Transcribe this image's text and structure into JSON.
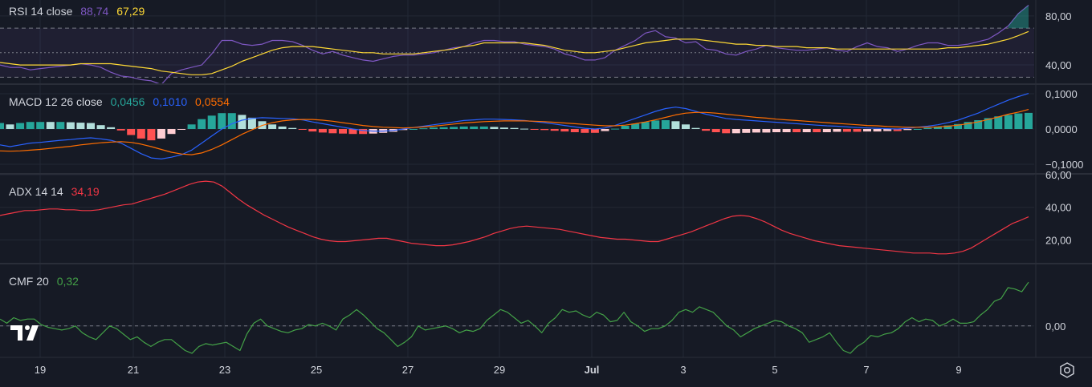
{
  "colors": {
    "background": "#161a25",
    "grid": "#232835",
    "pane_border": "#2a2e39",
    "text": "#d1d4dc",
    "rsi_line": "#7e57c2",
    "rsi_ma": "#fdd835",
    "macd_line": "#2962ff",
    "signal_line": "#ff6d00",
    "hist_up_strong": "#26a69a",
    "hist_up_weak": "#b2dfdb",
    "hist_down_strong": "#ff5252",
    "hist_down_weak": "#ffcdd2",
    "adx_line": "#f23645",
    "cmf_line": "#43a047"
  },
  "icons": {
    "logo": "tradingview-logo-icon",
    "settings": "gear-icon"
  },
  "panes": {
    "rsi": {
      "label": "RSI 14 close",
      "v1": "88,74",
      "v2": "67,29"
    },
    "macd": {
      "label": "MACD 12 26 close",
      "v1": "0,0456",
      "v2": "0,1010",
      "v3": "0,0554"
    },
    "adx": {
      "label": "ADX 14 14",
      "v1": "34,19"
    },
    "cmf": {
      "label": "CMF 20",
      "v1": "0,32"
    }
  },
  "chart_data": [
    {
      "type": "line",
      "name": "RSI",
      "x_ticks": [
        "19",
        "21",
        "23",
        "25",
        "27",
        "29",
        "Jul",
        "3",
        "5",
        "7",
        "9"
      ],
      "y_ticks": [
        "80,00",
        "40,00"
      ],
      "ylim": [
        25,
        93
      ],
      "bands": [
        70,
        50,
        30
      ],
      "series": [
        {
          "key": "rsi",
          "values": [
            40,
            38,
            38,
            36,
            37,
            38,
            39,
            40,
            41,
            40,
            38,
            34,
            31,
            30,
            28,
            27,
            24,
            33,
            36,
            38,
            40,
            49,
            60,
            60,
            57,
            56,
            57,
            60,
            60,
            59,
            56,
            52,
            49,
            51,
            48,
            46,
            44,
            43,
            45,
            47,
            48,
            48,
            49,
            50,
            52,
            54,
            55,
            58,
            60,
            60,
            59,
            59,
            57,
            56,
            55,
            53,
            49,
            47,
            44,
            44,
            46,
            52,
            56,
            60,
            66,
            68,
            63,
            62,
            58,
            59,
            53,
            52,
            49,
            48,
            51,
            53,
            56,
            54,
            53,
            52,
            52,
            53,
            54,
            52,
            51,
            55,
            58,
            55,
            54,
            51,
            53,
            56,
            58,
            58,
            56,
            56,
            57,
            59,
            61,
            66,
            72,
            82,
            88.74
          ]
        },
        {
          "key": "ma",
          "values": [
            42,
            41,
            40,
            40,
            40,
            40,
            40,
            40,
            41,
            41,
            41,
            41,
            40,
            39,
            38,
            37,
            35,
            34,
            33,
            32,
            32,
            33,
            36,
            39,
            43,
            46,
            49,
            52,
            54,
            55,
            55,
            55,
            54,
            53,
            52,
            51,
            50,
            50,
            49,
            49,
            49,
            49,
            50,
            51,
            52,
            53,
            55,
            56,
            58,
            58,
            58,
            58,
            58,
            57,
            56,
            54,
            52,
            51,
            50,
            50,
            51,
            52,
            54,
            56,
            58,
            59,
            60,
            61,
            61,
            61,
            60,
            59,
            58,
            57,
            57,
            56,
            56,
            55,
            55,
            55,
            54,
            54,
            54,
            53,
            53,
            53,
            53,
            53,
            53,
            53,
            53,
            53,
            53,
            53,
            54,
            54,
            55,
            56,
            57,
            59,
            61,
            64,
            67.29
          ]
        }
      ]
    },
    {
      "type": "line",
      "name": "MACD",
      "x_ticks": [
        "19",
        "21",
        "23",
        "25",
        "27",
        "29",
        "Jul",
        "3",
        "5",
        "7",
        "9"
      ],
      "y_ticks": [
        "0,1000",
        "0,0000",
        "−0,1000"
      ],
      "ylim": [
        -0.125,
        0.125
      ],
      "series": [
        {
          "key": "macd",
          "values": [
            -0.045,
            -0.05,
            -0.045,
            -0.04,
            -0.038,
            -0.035,
            -0.032,
            -0.03,
            -0.027,
            -0.025,
            -0.028,
            -0.032,
            -0.04,
            -0.055,
            -0.07,
            -0.082,
            -0.085,
            -0.08,
            -0.073,
            -0.06,
            -0.04,
            -0.02,
            0.0,
            0.015,
            0.025,
            0.03,
            0.032,
            0.031,
            0.03,
            0.029,
            0.026,
            0.02,
            0.015,
            0.01,
            0.005,
            0.0,
            -0.004,
            -0.006,
            -0.006,
            -0.004,
            0.0,
            0.004,
            0.008,
            0.012,
            0.016,
            0.02,
            0.024,
            0.026,
            0.028,
            0.028,
            0.027,
            0.026,
            0.024,
            0.021,
            0.018,
            0.014,
            0.01,
            0.006,
            0.002,
            0.0,
            0.003,
            0.01,
            0.02,
            0.03,
            0.04,
            0.05,
            0.058,
            0.062,
            0.058,
            0.05,
            0.042,
            0.036,
            0.03,
            0.027,
            0.025,
            0.023,
            0.021,
            0.019,
            0.017,
            0.015,
            0.013,
            0.011,
            0.009,
            0.008,
            0.006,
            0.004,
            0.003,
            0.002,
            0.001,
            0.0,
            0.002,
            0.005,
            0.008,
            0.012,
            0.018,
            0.025,
            0.035,
            0.045,
            0.058,
            0.07,
            0.082,
            0.092,
            0.101
          ]
        },
        {
          "key": "signal",
          "values": [
            -0.062,
            -0.063,
            -0.062,
            -0.06,
            -0.058,
            -0.055,
            -0.052,
            -0.049,
            -0.045,
            -0.042,
            -0.039,
            -0.037,
            -0.036,
            -0.038,
            -0.043,
            -0.05,
            -0.058,
            -0.066,
            -0.071,
            -0.073,
            -0.068,
            -0.058,
            -0.045,
            -0.03,
            -0.015,
            -0.002,
            0.01,
            0.018,
            0.023,
            0.026,
            0.027,
            0.027,
            0.025,
            0.022,
            0.018,
            0.014,
            0.01,
            0.007,
            0.005,
            0.004,
            0.003,
            0.004,
            0.006,
            0.008,
            0.011,
            0.014,
            0.017,
            0.019,
            0.021,
            0.022,
            0.023,
            0.023,
            0.023,
            0.022,
            0.021,
            0.019,
            0.017,
            0.015,
            0.013,
            0.011,
            0.009,
            0.009,
            0.011,
            0.015,
            0.02,
            0.026,
            0.033,
            0.04,
            0.045,
            0.047,
            0.047,
            0.045,
            0.042,
            0.039,
            0.036,
            0.033,
            0.031,
            0.028,
            0.026,
            0.024,
            0.022,
            0.02,
            0.018,
            0.016,
            0.014,
            0.012,
            0.01,
            0.009,
            0.007,
            0.006,
            0.005,
            0.005,
            0.005,
            0.006,
            0.008,
            0.011,
            0.015,
            0.02,
            0.027,
            0.034,
            0.042,
            0.048,
            0.0554
          ]
        }
      ]
    },
    {
      "type": "line",
      "name": "ADX",
      "x_ticks": [
        "19",
        "21",
        "23",
        "25",
        "27",
        "29",
        "Jul",
        "3",
        "5",
        "7",
        "9"
      ],
      "y_ticks": [
        "60,00",
        "40,00",
        "20,00"
      ],
      "ylim": [
        6,
        60
      ],
      "series": [
        {
          "key": "adx",
          "values": [
            35,
            36,
            37,
            38,
            38,
            38.5,
            39,
            39,
            38.5,
            38.5,
            38,
            38,
            38.5,
            39.5,
            40.5,
            41.5,
            42,
            43.5,
            45,
            46.5,
            48,
            50,
            52,
            54,
            55.5,
            56,
            55.5,
            53,
            49,
            45,
            41.5,
            38.5,
            35.5,
            33,
            30.5,
            28,
            26,
            24,
            22,
            20.5,
            19.5,
            19,
            19,
            19.5,
            20,
            20.5,
            21,
            21,
            20,
            19,
            18,
            17.5,
            17,
            16.5,
            16.5,
            17,
            18,
            19,
            20.5,
            22,
            24,
            25.5,
            27,
            28,
            28.5,
            28,
            27.5,
            27,
            26.5,
            25.5,
            24.5,
            23.5,
            22.5,
            21.5,
            21,
            20.5,
            20.5,
            20,
            19.5,
            19,
            19,
            20.5,
            22,
            23.5,
            25,
            27,
            29,
            31,
            33,
            34.5,
            35,
            34.5,
            33,
            31,
            28.5,
            26,
            24,
            22.5,
            21,
            19.5,
            18.5,
            17.5,
            16.5,
            16,
            15.5,
            15,
            14.5,
            14,
            13.5,
            13,
            12.5,
            12,
            12,
            12,
            11.5,
            11.5,
            12,
            13,
            15,
            18,
            21,
            24,
            27,
            30,
            32,
            34.19
          ]
        }
      ]
    },
    {
      "type": "line",
      "name": "CMF",
      "x_ticks": [
        "19",
        "21",
        "23",
        "25",
        "27",
        "29",
        "Jul",
        "3",
        "5",
        "7",
        "9"
      ],
      "y_ticks": [
        "0,00"
      ],
      "ylim": [
        -0.23,
        0.45
      ],
      "series": [
        {
          "key": "cmf",
          "values": [
            0.05,
            0.02,
            0.06,
            0.04,
            0.05,
            0.05,
            0.01,
            -0.01,
            -0.02,
            -0.03,
            -0.02,
            0.0,
            -0.05,
            -0.08,
            -0.1,
            -0.05,
            0.0,
            -0.02,
            -0.06,
            -0.1,
            -0.08,
            -0.12,
            -0.15,
            -0.12,
            -0.1,
            -0.1,
            -0.14,
            -0.18,
            -0.2,
            -0.15,
            -0.13,
            -0.14,
            -0.13,
            -0.12,
            -0.15,
            -0.18,
            -0.06,
            0.02,
            0.05,
            0.0,
            -0.02,
            -0.04,
            -0.05,
            -0.03,
            -0.02,
            0.01,
            0.0,
            0.02,
            0.0,
            -0.03,
            0.05,
            0.08,
            0.12,
            0.08,
            0.03,
            -0.02,
            -0.05,
            -0.1,
            -0.15,
            -0.12,
            -0.08,
            0.0,
            -0.03,
            -0.02,
            -0.01,
            0.0,
            -0.02,
            -0.05,
            -0.03,
            -0.04,
            -0.02,
            0.04,
            0.08,
            0.12,
            0.1,
            0.06,
            0.02,
            0.04,
            0.0,
            -0.05,
            0.02,
            0.06,
            0.12,
            0.1,
            0.11,
            0.08,
            0.06,
            0.1,
            0.08,
            0.03,
            0.04,
            0.1,
            0.03,
            0.0,
            -0.04,
            -0.02,
            -0.02,
            0.0,
            0.04,
            0.1,
            0.12,
            0.1,
            0.14,
            0.12,
            0.1,
            0.05,
            0.0,
            -0.03,
            -0.08,
            -0.05,
            -0.02,
            0.0,
            0.02,
            0.04,
            0.03,
            0.0,
            -0.02,
            -0.05,
            -0.12,
            -0.1,
            -0.08,
            -0.05,
            -0.12,
            -0.18,
            -0.2,
            -0.15,
            -0.12,
            -0.07,
            -0.08,
            -0.06,
            -0.05,
            -0.02,
            0.03,
            0.06,
            0.03,
            0.05,
            0.04,
            0.0,
            0.02,
            0.05,
            0.02,
            0.02,
            0.03,
            0.08,
            0.12,
            0.18,
            0.2,
            0.28,
            0.27,
            0.25,
            0.32
          ]
        }
      ]
    }
  ]
}
